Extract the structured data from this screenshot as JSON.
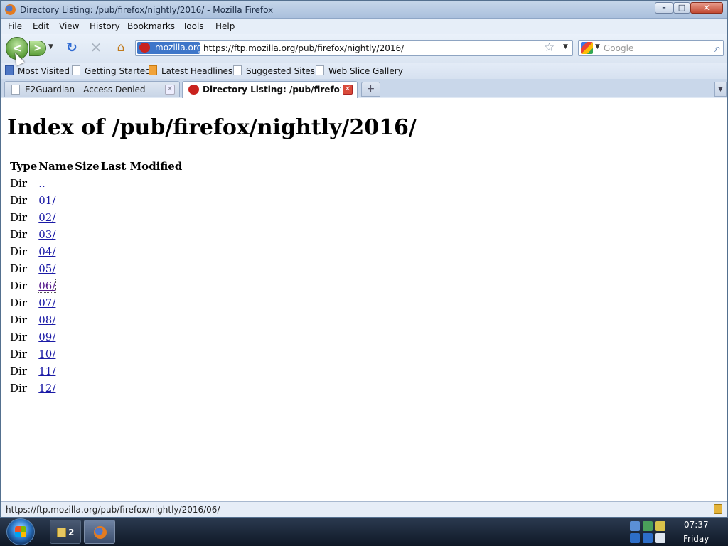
{
  "window": {
    "title": "Directory Listing: /pub/firefox/nightly/2016/ - Mozilla Firefox"
  },
  "menu": [
    "File",
    "Edit",
    "View",
    "History",
    "Bookmarks",
    "Tools",
    "Help"
  ],
  "navigation": {
    "site_identity": "mozilla.org",
    "url": "https://ftp.mozilla.org/pub/firefox/nightly/2016/",
    "search_placeholder": "Google"
  },
  "bookmarks": [
    "Most Visited",
    "Getting Started",
    "Latest Headlines",
    "Suggested Sites",
    "Web Slice Gallery"
  ],
  "tabs": [
    {
      "label": "E2Guardian - Access Denied",
      "active": false
    },
    {
      "label": "Directory Listing: /pub/firefox/...",
      "active": true
    }
  ],
  "page": {
    "heading": "Index of /pub/firefox/nightly/2016/",
    "columns": [
      "Type",
      "Name",
      "Size",
      "Last Modified"
    ],
    "rows": [
      {
        "type": "Dir",
        "name": ".."
      },
      {
        "type": "Dir",
        "name": "01/"
      },
      {
        "type": "Dir",
        "name": "02/"
      },
      {
        "type": "Dir",
        "name": "03/"
      },
      {
        "type": "Dir",
        "name": "04/"
      },
      {
        "type": "Dir",
        "name": "05/"
      },
      {
        "type": "Dir",
        "name": "06/"
      },
      {
        "type": "Dir",
        "name": "07/"
      },
      {
        "type": "Dir",
        "name": "08/"
      },
      {
        "type": "Dir",
        "name": "09/"
      },
      {
        "type": "Dir",
        "name": "10/"
      },
      {
        "type": "Dir",
        "name": "11/"
      },
      {
        "type": "Dir",
        "name": "12/"
      }
    ],
    "focused_row": "06/"
  },
  "status": {
    "text": "https://ftp.mozilla.org/pub/firefox/nightly/2016/06/"
  },
  "taskbar": {
    "group_count": "2",
    "time": "07:37",
    "day": "Friday"
  },
  "colors": {
    "link": "#1a1aa6",
    "visited_link": "#551a8b",
    "site_identity": "#3e76c9"
  }
}
